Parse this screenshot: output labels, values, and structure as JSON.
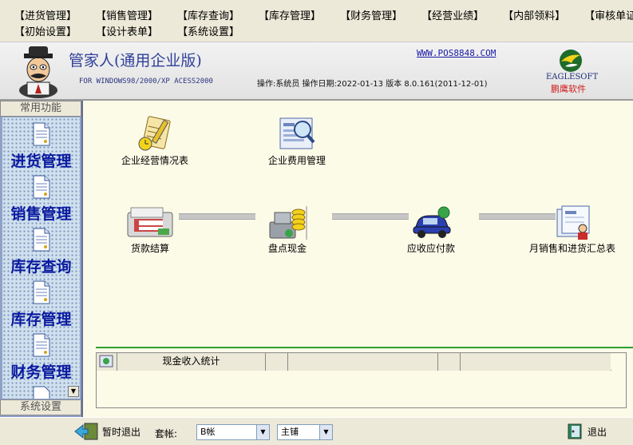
{
  "menu": {
    "row1": [
      "【进货管理】",
      "【销售管理】",
      "【库存查询】",
      "【库存管理】",
      "【财务管理】",
      "【经营业绩】",
      "【内部领料】",
      "【审核单证】"
    ],
    "row2": [
      "【初始设置】",
      "【设计表单】",
      "【系统设置】"
    ]
  },
  "header": {
    "title": "管家人(通用企业版)",
    "website": "WWW.POS8848.COM",
    "platform": "FOR WINDOWS98/2000/XP  ACESS2000",
    "status": "操作:系统员 操作日期:2022-01-13 版本 8.0.161(2011-12-01)",
    "brand_en": "EAGLESOFT",
    "brand_cn": "鹏鹰软件"
  },
  "sidebar": {
    "top_label": "常用功能",
    "items": [
      "进货管理",
      "销售管理",
      "库存查询",
      "库存管理",
      "财务管理"
    ],
    "bottom_label": "系统设置"
  },
  "main": {
    "tiles": [
      "企业经营情况表",
      "企业费用管理",
      "货款结算",
      "盘点现金",
      "应收应付款",
      "月销售和进货汇总表"
    ],
    "stats_title": "现金收入统计"
  },
  "bottom": {
    "pause_label": "暂时退出",
    "account_label": "套帐:",
    "account_value": "B帐",
    "store_value": "主铺",
    "exit_label": "退出"
  },
  "colors": {
    "title_blue": "#2e3f9a",
    "sidebar_text": "#0a1aa0",
    "brand_red": "#d11a1a",
    "divider_green": "#2c9f2c"
  }
}
